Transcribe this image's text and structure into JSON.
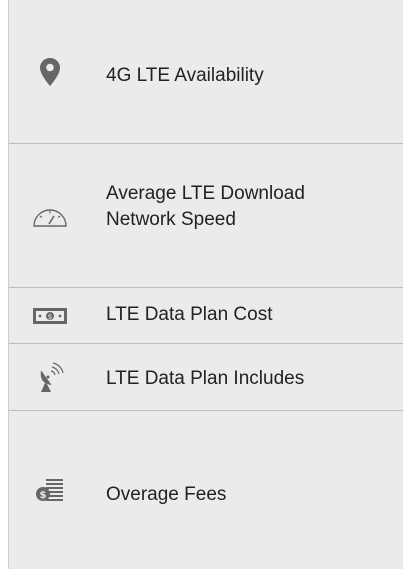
{
  "rows": [
    {
      "label": "4G LTE Availability",
      "icon": "location-pin-icon"
    },
    {
      "label": "Average LTE Download Network Speed",
      "icon": "speedometer-icon"
    },
    {
      "label": "LTE Data Plan Cost",
      "icon": "money-bill-icon"
    },
    {
      "label": "LTE Data Plan Includes",
      "icon": "satellite-dish-icon"
    },
    {
      "label": "Overage Fees",
      "icon": "coin-list-icon"
    }
  ],
  "colors": {
    "background": "#ebebeb",
    "divider": "#bdbdbd",
    "text": "#222222",
    "icon": "#666666"
  }
}
